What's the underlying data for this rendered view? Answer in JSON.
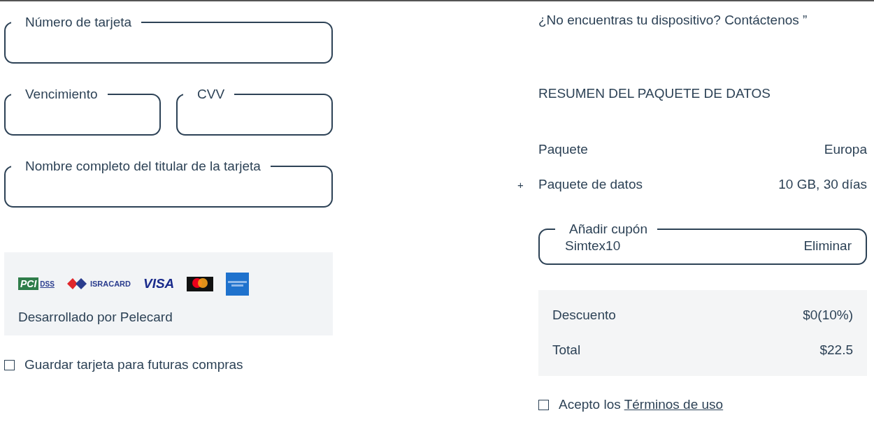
{
  "card_form": {
    "rows": [
      [
        {
          "label": "Número de tarjeta"
        }
      ],
      [
        {
          "label": "Vencimiento"
        },
        {
          "label": "CVV"
        }
      ],
      [
        {
          "label": "Nombre completo del titular de la tarjeta"
        }
      ]
    ]
  },
  "payment_box": {
    "logos": [
      {
        "kind": "pci",
        "mark": "PCI",
        "text": "DSS"
      },
      {
        "kind": "isracard",
        "text": "ISRACARD"
      },
      {
        "kind": "visa",
        "text": "VISA"
      },
      {
        "kind": "mastercard"
      },
      {
        "kind": "amex"
      }
    ],
    "powered_by": "Desarrollado por Pelecard"
  },
  "save_card": {
    "label": "Guardar tarjeta para futuras compras",
    "checked": false
  },
  "contact_text": "¿No encuentras tu dispositivo? Contáctenos ”",
  "summary": {
    "title": "RESUMEN DEL PAQUETE DE DATOS",
    "rows": [
      {
        "label": "Paquete",
        "value": "Europa"
      },
      {
        "marker": "+",
        "label": "Paquete de datos",
        "value": "10 GB, 30 días"
      }
    ]
  },
  "coupon": {
    "label": "Añadir cupón",
    "value": "Simtex10",
    "remove_label": "Eliminar"
  },
  "totals": [
    {
      "label": "Descuento",
      "value": "$0(10%)"
    },
    {
      "label": "Total",
      "value": "$22.5"
    }
  ],
  "terms": {
    "text": "Acepto los ",
    "link": "Términos de uso",
    "checked": false
  }
}
